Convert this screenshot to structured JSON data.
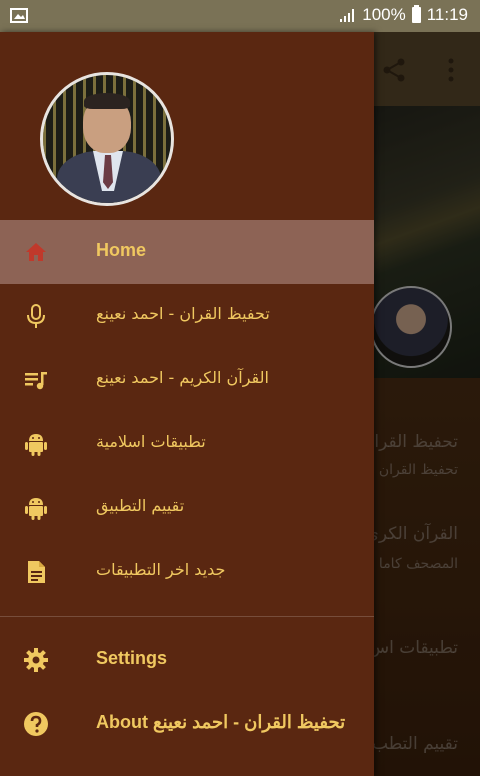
{
  "status_bar": {
    "battery": "100%",
    "time": "11:19"
  },
  "background_app": {
    "items": [
      {
        "title": "تحفيظ القرا",
        "subtitle": "تحفيظ القران"
      },
      {
        "title": "القرآن الكري",
        "subtitle": "المصحف كاما"
      },
      {
        "title": "تطبيقات اس",
        "subtitle": ""
      },
      {
        "title": "تقييم التطب",
        "subtitle": ""
      }
    ]
  },
  "drawer": {
    "menu": [
      {
        "label": "Home",
        "icon": "home-icon",
        "active": true
      },
      {
        "label": "تحفيظ القران - احمد نعينع",
        "icon": "microphone-icon",
        "active": false
      },
      {
        "label": "القرآن الكريم - احمد نعينع",
        "icon": "music-list-icon",
        "active": false
      },
      {
        "label": "تطبيقات اسلامية",
        "icon": "android-icon",
        "active": false
      },
      {
        "label": "تقييم التطبيق",
        "icon": "android-icon",
        "active": false
      },
      {
        "label": "جديد اخر التطبيقات",
        "icon": "document-icon",
        "active": false
      }
    ],
    "settings_label": "Settings",
    "about_label": "About تحفيظ القران - احمد نعينع"
  },
  "colors": {
    "drawer_bg": "#5a2711",
    "active_bg": "#8d6355",
    "accent": "#f0c860",
    "home_icon": "#c0392b"
  }
}
